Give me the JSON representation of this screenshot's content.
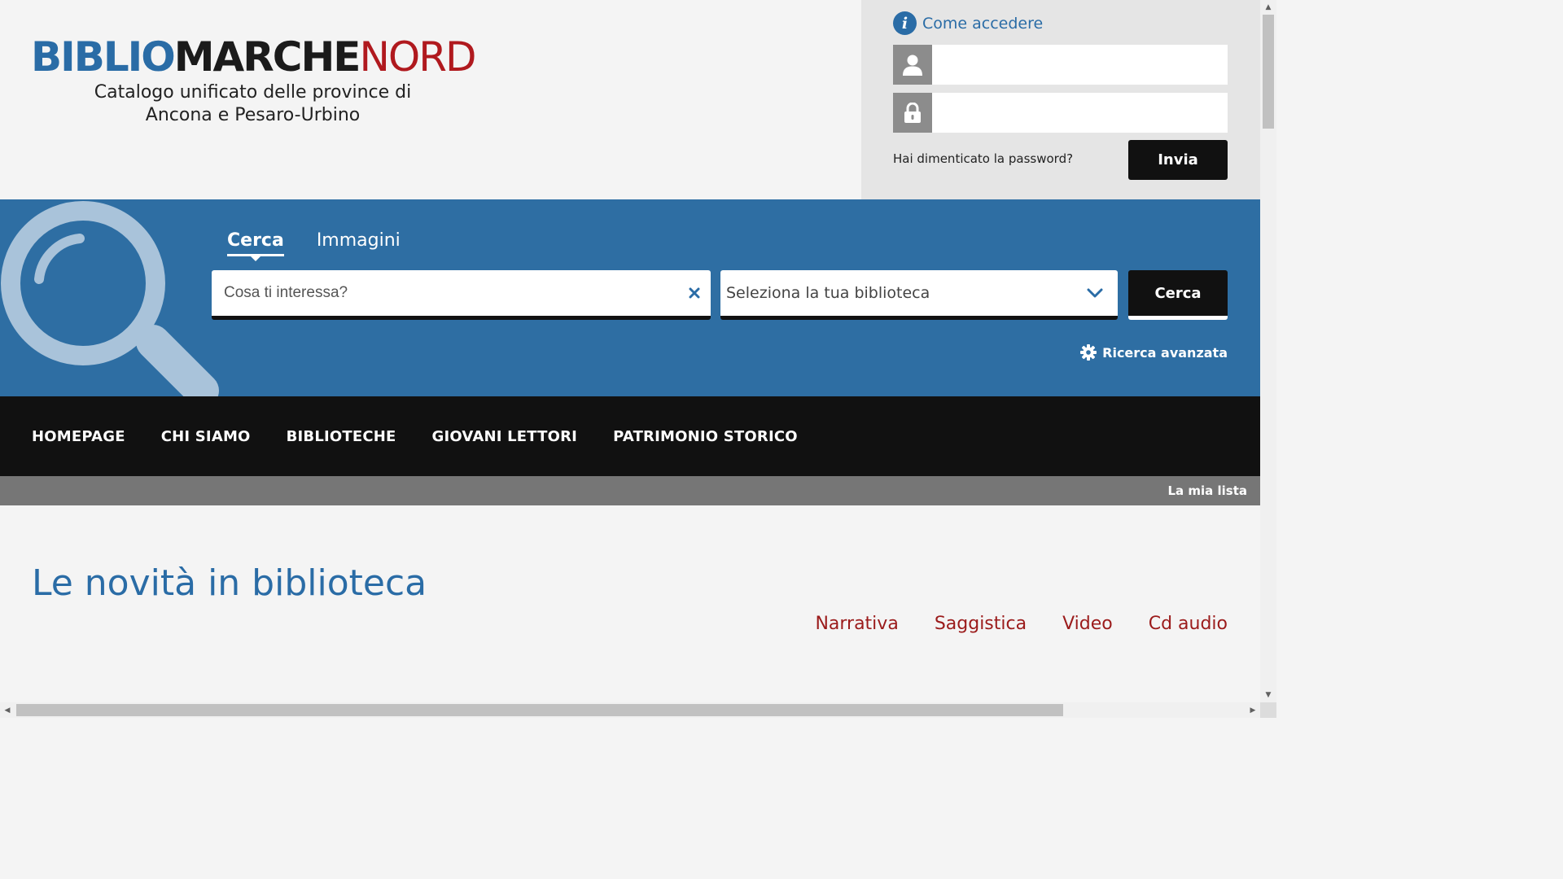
{
  "brand": {
    "part1": "BIBLIO",
    "part2": "MARCHE",
    "part3": "NORD",
    "subtitle_line1": "Catalogo unificato delle province di",
    "subtitle_line2": "Ancona e Pesaro-Urbino",
    "colors": {
      "blue": "#2a6ca6",
      "dark": "#1b1b1b",
      "red": "#b0191e"
    }
  },
  "login": {
    "how_to_access": "Come accedere",
    "username_value": "",
    "password_value": "",
    "forgot_password": "Hai dimenticato la password?",
    "submit_label": "Invia",
    "icons": [
      "info-icon",
      "user-icon",
      "lock-icon"
    ]
  },
  "search": {
    "tabs": [
      {
        "label": "Cerca",
        "active": true
      },
      {
        "label": "Immagini",
        "active": false
      }
    ],
    "query_placeholder": "Cosa ti interessa?",
    "query_value": "",
    "library_select_value": "Seleziona la tua biblioteca",
    "search_button": "Cerca",
    "advanced_search": "Ricerca avanzata",
    "band_color": "#2e6ea3"
  },
  "nav": {
    "items": [
      "HOMEPAGE",
      "CHI SIAMO",
      "BIBLIOTECHE",
      "GIOVANI LETTORI",
      "PATRIMONIO STORICO"
    ]
  },
  "subbar": {
    "my_list": "La mia lista"
  },
  "content": {
    "title": "Le novità in biblioteca",
    "filters": [
      "Narrativa",
      "Saggistica",
      "Video",
      "Cd audio"
    ],
    "filter_color": "#9b1b1b"
  }
}
